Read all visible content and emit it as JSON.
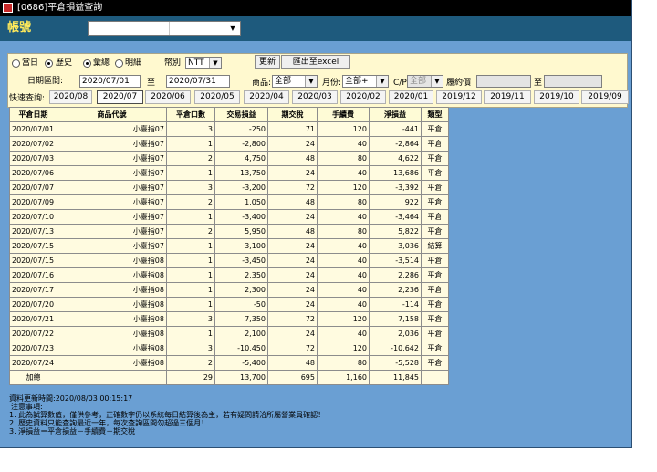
{
  "window": {
    "title": "[0686]平倉損益查詢"
  },
  "account": {
    "label": "帳號",
    "value": ""
  },
  "filters": {
    "range_options": [
      {
        "label": "當日",
        "selected": false
      },
      {
        "label": "歷史",
        "selected": true
      }
    ],
    "view_options": [
      {
        "label": "彙總",
        "selected": true
      },
      {
        "label": "明細",
        "selected": false
      }
    ],
    "currency_label": "幣別:",
    "currency_value": "NTT",
    "refresh_label": "更新",
    "export_label": "匯出至excel",
    "date_range_label": "日期區間:",
    "date_from": "2020/07/01",
    "to_label": "至",
    "date_to": "2020/07/31",
    "product_label": "商品:",
    "product_value": "全部",
    "month_label": "月份:",
    "month_value": "全部+",
    "cp_label": "C/P",
    "cp_value": "全部",
    "strike_label": "履約價",
    "strike_from": "",
    "strike_to_label": "至",
    "strike_to": ""
  },
  "quick": {
    "label": "快速查詢:",
    "months": [
      "2020/08",
      "2020/07",
      "2020/06",
      "2020/05",
      "2020/04",
      "2020/03",
      "2020/02",
      "2020/01",
      "2019/12",
      "2019/11",
      "2019/10",
      "2019/09"
    ],
    "active": "2020/07"
  },
  "table": {
    "headers": [
      "平倉日期",
      "商品代號",
      "平倉口數",
      "交易損益",
      "期交稅",
      "手續費",
      "淨損益",
      "類型"
    ],
    "rows": [
      [
        "2020/07/01",
        "小臺指07",
        "3",
        "-250",
        "71",
        "120",
        "-441",
        "平倉"
      ],
      [
        "2020/07/02",
        "小臺指07",
        "1",
        "-2,800",
        "24",
        "40",
        "-2,864",
        "平倉"
      ],
      [
        "2020/07/03",
        "小臺指07",
        "2",
        "4,750",
        "48",
        "80",
        "4,622",
        "平倉"
      ],
      [
        "2020/07/06",
        "小臺指07",
        "1",
        "13,750",
        "24",
        "40",
        "13,686",
        "平倉"
      ],
      [
        "2020/07/07",
        "小臺指07",
        "3",
        "-3,200",
        "72",
        "120",
        "-3,392",
        "平倉"
      ],
      [
        "2020/07/09",
        "小臺指07",
        "2",
        "1,050",
        "48",
        "80",
        "922",
        "平倉"
      ],
      [
        "2020/07/10",
        "小臺指07",
        "1",
        "-3,400",
        "24",
        "40",
        "-3,464",
        "平倉"
      ],
      [
        "2020/07/13",
        "小臺指07",
        "2",
        "5,950",
        "48",
        "80",
        "5,822",
        "平倉"
      ],
      [
        "2020/07/15",
        "小臺指07",
        "1",
        "3,100",
        "24",
        "40",
        "3,036",
        "結算"
      ],
      [
        "2020/07/15",
        "小臺指08",
        "1",
        "-3,450",
        "24",
        "40",
        "-3,514",
        "平倉"
      ],
      [
        "2020/07/16",
        "小臺指08",
        "1",
        "2,350",
        "24",
        "40",
        "2,286",
        "平倉"
      ],
      [
        "2020/07/17",
        "小臺指08",
        "1",
        "2,300",
        "24",
        "40",
        "2,236",
        "平倉"
      ],
      [
        "2020/07/20",
        "小臺指08",
        "1",
        "-50",
        "24",
        "40",
        "-114",
        "平倉"
      ],
      [
        "2020/07/21",
        "小臺指08",
        "3",
        "7,350",
        "72",
        "120",
        "7,158",
        "平倉"
      ],
      [
        "2020/07/22",
        "小臺指08",
        "1",
        "2,100",
        "24",
        "40",
        "2,036",
        "平倉"
      ],
      [
        "2020/07/23",
        "小臺指08",
        "3",
        "-10,450",
        "72",
        "120",
        "-10,642",
        "平倉"
      ],
      [
        "2020/07/24",
        "小臺指08",
        "2",
        "-5,400",
        "48",
        "80",
        "-5,528",
        "平倉"
      ]
    ],
    "total": [
      "加總",
      "",
      "29",
      "13,700",
      "695",
      "1,160",
      "11,845",
      ""
    ]
  },
  "notes": {
    "updated": "資料更新時間:2020/08/03 00:15:17",
    "title": "注意事項:",
    "lines": [
      "1. 此為試算數值，僅供參考，正確數字仍以系統每日結算後為主，若有疑問請洽所屬營業員確認！",
      "2. 歷史資料只能查詢最近一年，每次查詢區間勿超過三個月！",
      "3. 淨損益＝平倉損益－手續費－期交稅"
    ]
  }
}
